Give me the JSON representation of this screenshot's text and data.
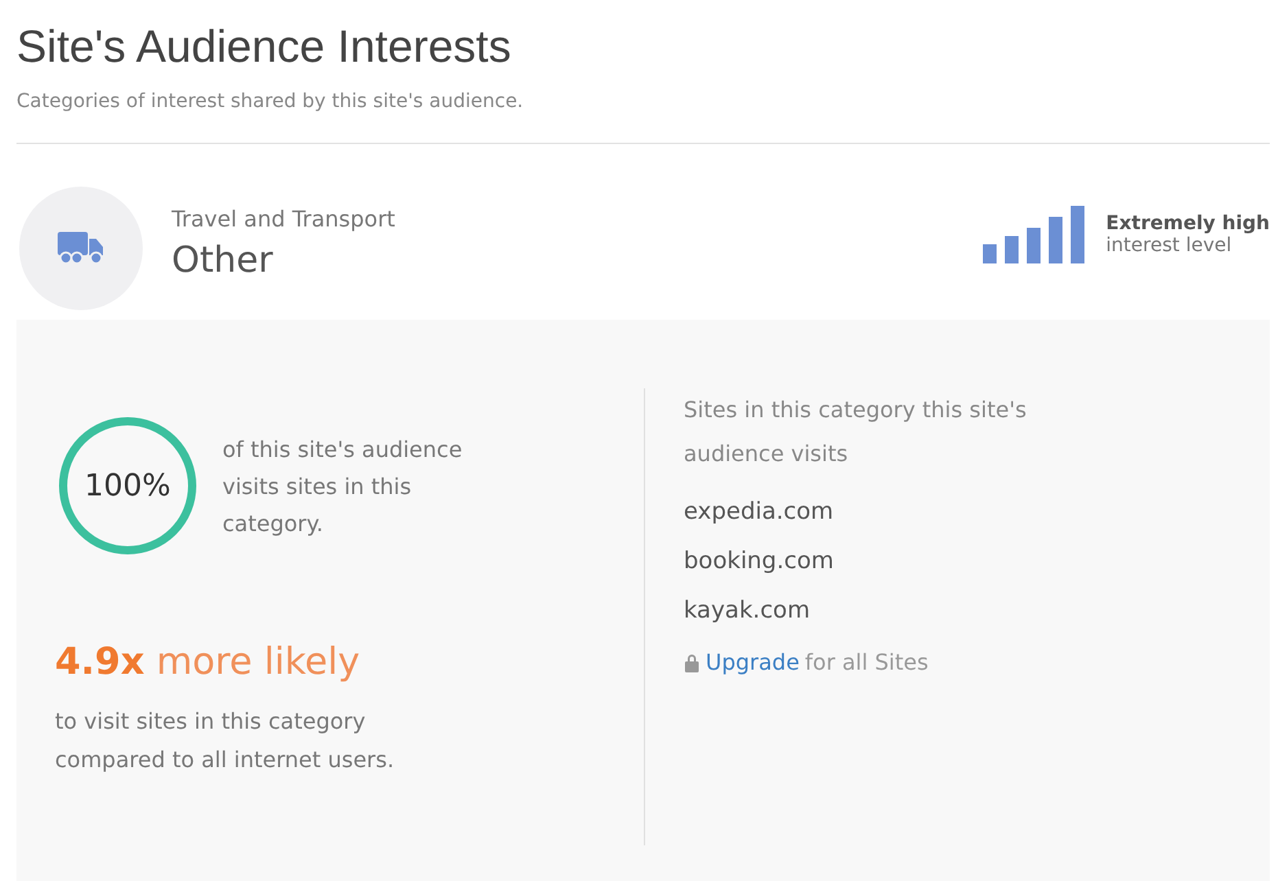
{
  "title": "Site's Audience Interests",
  "subtitle": "Categories of interest shared by this site's audience.",
  "category": {
    "group": "Travel and Transport",
    "name": "Other"
  },
  "interest": {
    "label": "Extremely high",
    "caption": "interest level"
  },
  "share": {
    "percent": "100%",
    "text": "of this site's audience visits sites in this category."
  },
  "likelihood": {
    "headline": "**4.9x** more likely",
    "text": "to visit sites in this category compared to all internet users."
  },
  "sites": {
    "heading": "Sites in this category this site's audience visits",
    "items": [
      "expedia.com",
      "booking.com",
      "kayak.com"
    ],
    "upgrade": {
      "link": "Upgrade",
      "rest": "for all Sites"
    }
  }
}
